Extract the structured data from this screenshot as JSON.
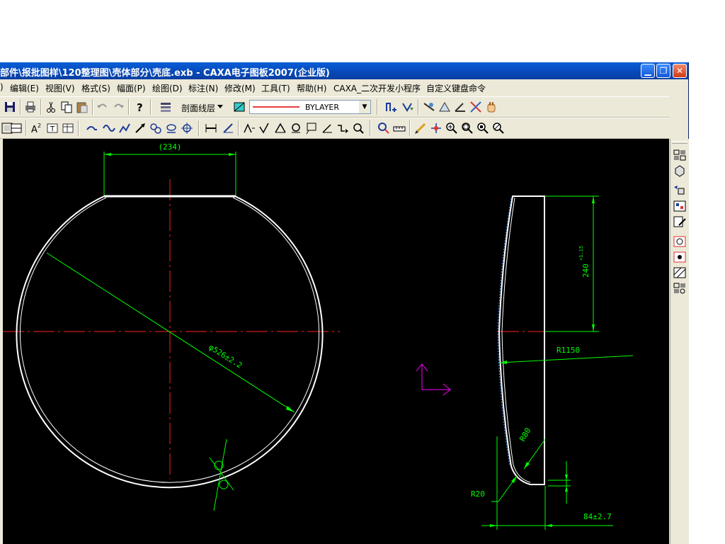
{
  "window": {
    "title": "部件\\报批图样\\120整理图\\壳体部分\\壳底.exb - CAXA电子图板2007(企业版)",
    "minimize_label": "▁",
    "restore_label": "❐",
    "close_label": "✕"
  },
  "menu": {
    "file_fragment": ")",
    "edit": "编辑(E)",
    "view": "视图(V)",
    "format": "格式(S)",
    "sheet": "幅面(P)",
    "draw": "绘图(D)",
    "annotate": "标注(N)",
    "modify": "修改(M)",
    "tools": "工具(T)",
    "help": "帮助(H)",
    "caxa_dev": "CAXA_二次开发小程序",
    "custom_keys": "自定义键盘命令"
  },
  "toolbar": {
    "layer_name": "剖面线层",
    "linetype_value": "BYLAYER"
  },
  "drawing": {
    "dim_width": "(234)",
    "dim_diameter": "φ526±2.2",
    "dim_height": "240",
    "dim_height_tol": "+1.15",
    "dim_r1150": "R1150",
    "dim_r80": "R80",
    "dim_r20": "R20",
    "dim_depth": "84±2.7"
  },
  "colors": {
    "canvas": "#000000",
    "outline": "#ffffff",
    "centerline": "#ff2020",
    "dimension": "#00ff00",
    "ucs": "#ff00ff"
  }
}
